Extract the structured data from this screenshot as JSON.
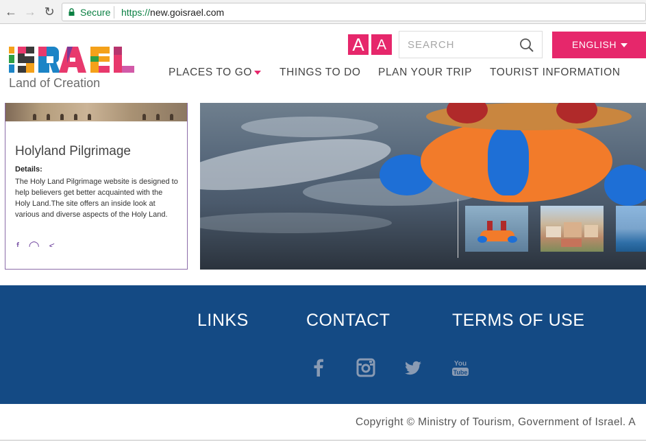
{
  "browser": {
    "secure_label": "Secure",
    "url_protocol": "https://",
    "url_host": "new.goisrael.com"
  },
  "header": {
    "logo_text": "Land of Creation",
    "font_large_label": "A",
    "font_small_label": "A",
    "search_placeholder": "SEARCH",
    "language": "ENGLISH"
  },
  "nav": {
    "items": [
      {
        "label": "PLACES TO GO"
      },
      {
        "label": "THINGS TO DO"
      },
      {
        "label": "PLAN YOUR TRIP"
      },
      {
        "label": "TOURIST INFORMATION"
      }
    ]
  },
  "card": {
    "title": "Holyland Pilgrimage",
    "details_label": "Details:",
    "description": "The Holy Land Pilgrimage website is designed to help believers get better acquainted with the Holy Land.The site offers an inside look at various and diverse aspects of the Holy Land."
  },
  "footer": {
    "links": [
      {
        "label": "LINKS"
      },
      {
        "label": "CONTACT"
      },
      {
        "label": "TERMS OF USE"
      }
    ],
    "copyright": "Copyright © Ministry of Tourism, Government of Israel. A"
  },
  "colors": {
    "accent": "#e6276b",
    "footer_bg": "#144a84",
    "secure_green": "#0b8043"
  },
  "icons": [
    "back-icon",
    "forward-icon",
    "reload-icon",
    "lock-icon",
    "search-icon",
    "facebook-icon",
    "instagram-icon",
    "twitter-icon",
    "youtube-icon"
  ]
}
